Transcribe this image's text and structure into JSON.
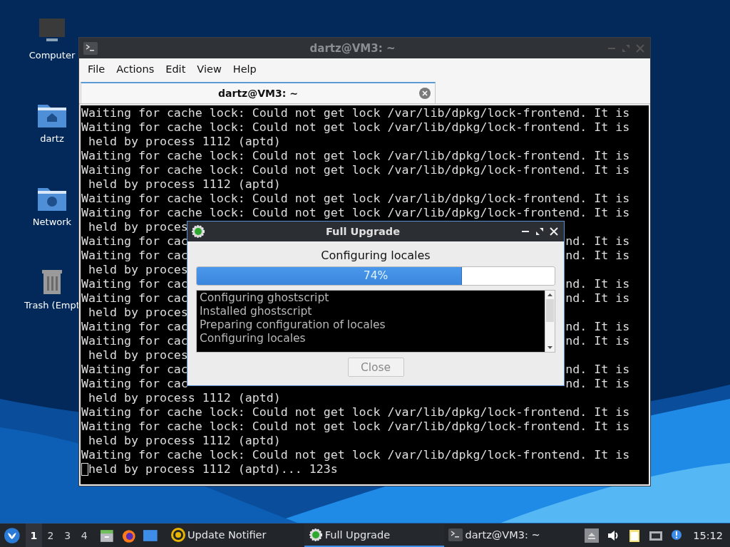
{
  "desktop_icons": [
    {
      "label": "Computer",
      "kind": "computer"
    },
    {
      "label": "dartz",
      "kind": "home"
    },
    {
      "label": "Network",
      "kind": "network"
    },
    {
      "label": "Trash (Empt",
      "kind": "trash"
    }
  ],
  "terminal": {
    "title": "dartz@VM3: ~",
    "menu": [
      "File",
      "Actions",
      "Edit",
      "View",
      "Help"
    ],
    "tabs": [
      {
        "label": "dartz@VM3: ~",
        "selected": true
      }
    ],
    "lines": [
      {
        "text": "Waiting for cache lock: Could not get lock /var/lib/dpkg/lock-frontend. It is",
        "cursor": false
      },
      {
        "text": "Waiting for cache lock: Could not get lock /var/lib/dpkg/lock-frontend. It is",
        "cursor": false
      },
      {
        "text": " held by process 1112 (aptd)",
        "cursor": false
      },
      {
        "text": "Waiting for cache lock: Could not get lock /var/lib/dpkg/lock-frontend. It is",
        "cursor": false
      },
      {
        "text": "Waiting for cache lock: Could not get lock /var/lib/dpkg/lock-frontend. It is",
        "cursor": false
      },
      {
        "text": " held by process 1112 (aptd)",
        "cursor": false
      },
      {
        "text": "Waiting for cache lock: Could not get lock /var/lib/dpkg/lock-frontend. It is",
        "cursor": false
      },
      {
        "text": "Waiting for cache lock: Could not get lock /var/lib/dpkg/lock-frontend. It is",
        "cursor": false
      },
      {
        "text": " held by proces",
        "cursor": false
      },
      {
        "text": "Waiting for cac",
        "tail": "nd. It is",
        "cursor": false
      },
      {
        "text": "Waiting for cac",
        "tail": "nd. It is",
        "cursor": false
      },
      {
        "text": " held by proces",
        "cursor": false
      },
      {
        "text": "Waiting for cac",
        "tail": "nd. It is",
        "cursor": false
      },
      {
        "text": "Waiting for cac",
        "tail": "nd. It is",
        "cursor": false
      },
      {
        "text": " held by proces",
        "cursor": false
      },
      {
        "text": "Waiting for cac",
        "tail": "nd. It is",
        "cursor": false
      },
      {
        "text": "Waiting for cac",
        "tail": "nd. It is",
        "cursor": false
      },
      {
        "text": " held by proces",
        "cursor": false
      },
      {
        "text": "Waiting for cac",
        "tail": "nd. It is",
        "cursor": false
      },
      {
        "text": "Waiting for cac",
        "tail": "nd. It is",
        "cursor": false
      },
      {
        "text": " held by process 1112 (aptd)",
        "cursor": false
      },
      {
        "text": "Waiting for cache lock: Could not get lock /var/lib/dpkg/lock-frontend. It is",
        "cursor": false
      },
      {
        "text": "Waiting for cache lock: Could not get lock /var/lib/dpkg/lock-frontend. It is",
        "cursor": false
      },
      {
        "text": " held by process 1112 (aptd)",
        "cursor": false
      },
      {
        "text": "Waiting for cache lock: Could not get lock /var/lib/dpkg/lock-frontend. It is",
        "cursor": false
      },
      {
        "text": "held by process 1112 (aptd)... 123s",
        "cursor": true
      }
    ]
  },
  "dialog": {
    "title": "Full Upgrade",
    "status": "Configuring locales",
    "progress": {
      "level": 0.74,
      "reading": "74%"
    },
    "log": [
      "Configuring ghostscript",
      "Installed ghostscript",
      "Preparing configuration of locales",
      "Configuring locales"
    ],
    "buttons": [
      {
        "label": "Close",
        "disabled": true
      }
    ]
  },
  "taskbar": {
    "workspaces": [
      {
        "label": "1",
        "selected": true
      },
      {
        "label": "2",
        "selected": false
      },
      {
        "label": "3",
        "selected": false
      },
      {
        "label": "4",
        "selected": false
      }
    ],
    "launchers": [
      {
        "kind": "files"
      },
      {
        "kind": "browser"
      },
      {
        "kind": "desktop"
      }
    ],
    "tasks": [
      {
        "label": "Update Notifier",
        "kind": "notifier",
        "selected": false
      },
      {
        "label": "Full Upgrade",
        "kind": "upgrade",
        "selected": true
      },
      {
        "label": "dartz@VM3: ~",
        "kind": "terminal",
        "selected": false
      }
    ],
    "tray": [
      {
        "kind": "eject"
      },
      {
        "kind": "volume"
      },
      {
        "kind": "clipboard"
      },
      {
        "kind": "network"
      },
      {
        "kind": "alert"
      }
    ],
    "clock": "15:12"
  }
}
